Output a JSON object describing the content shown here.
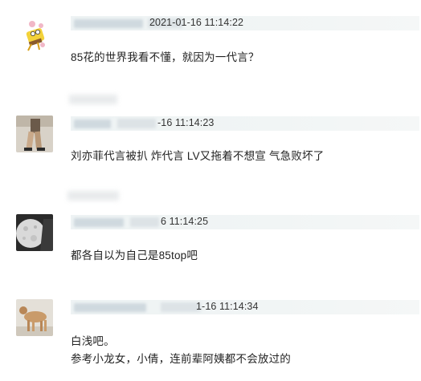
{
  "comments": [
    {
      "timestamp": "2021-01-16 11:14:22",
      "lines": [
        "85花的世界我看不懂，就因为一代言？"
      ]
    },
    {
      "timestamp": "-16 11:14:23",
      "lines": [
        "刘亦菲代言被扒 炸代言 LV又拖着不想宣 气急败坏了"
      ]
    },
    {
      "timestamp": "6 11:14:25",
      "lines": [
        "都各自以为自己是85top吧"
      ]
    },
    {
      "timestamp": "1-16 11:14:34",
      "lines": [
        "白浅吧。",
        "参考小龙女，小倩，连前辈阿姨都不会放过的"
      ]
    }
  ],
  "colors": {
    "header_bg": "#eef3f4",
    "text": "#222222",
    "timestamp": "#333333"
  },
  "avatars": [
    "cartoon-sponge-avatar",
    "person-legs-avatar",
    "moon-avatar",
    "dog-avatar"
  ]
}
